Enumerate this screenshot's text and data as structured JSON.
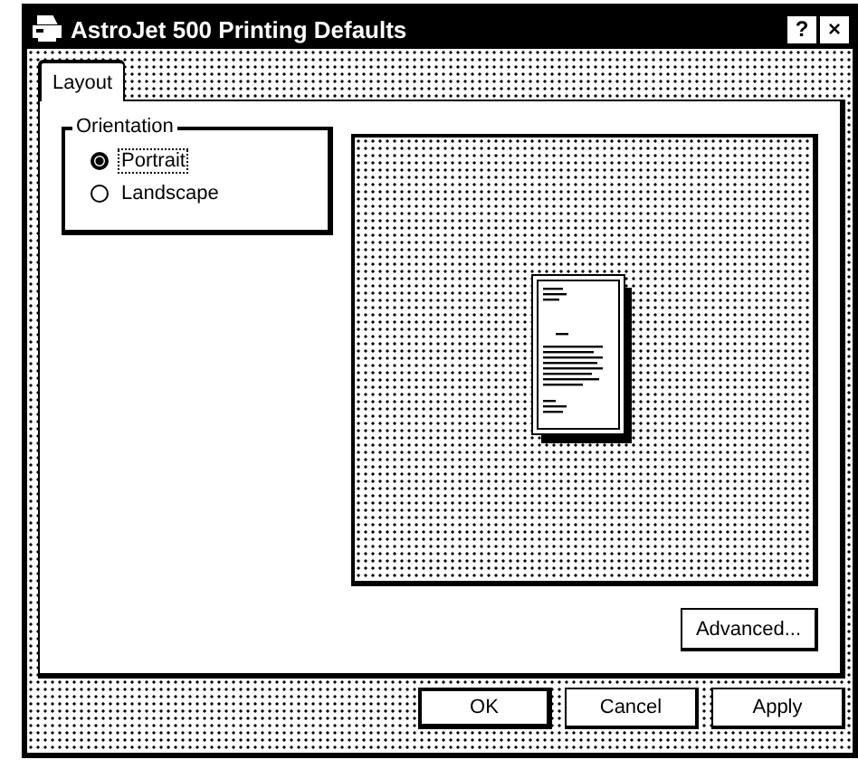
{
  "window": {
    "title": "AstroJet 500 Printing Defaults",
    "title_buttons": [
      "?",
      "×"
    ]
  },
  "tabs": [
    {
      "label": "Layout",
      "selected": true
    }
  ],
  "orientation": {
    "label": "Orientation",
    "options": [
      {
        "label": "Portrait",
        "selected": true,
        "focused": true
      },
      {
        "label": "Landscape",
        "selected": false,
        "focused": false
      }
    ]
  },
  "advanced_button": "Advanced...",
  "buttons": [
    "OK",
    "Cancel",
    "Apply"
  ]
}
